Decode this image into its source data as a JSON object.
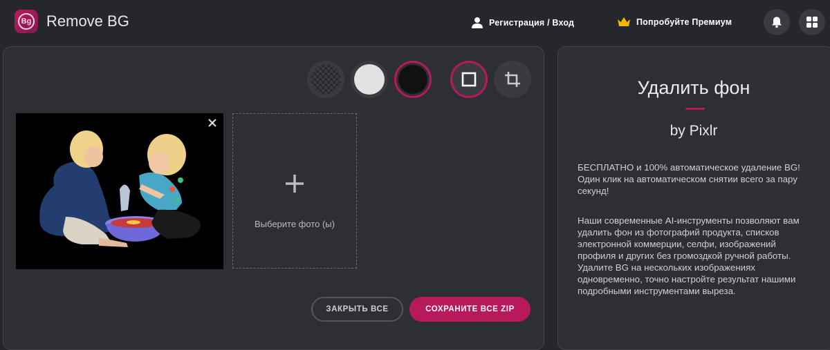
{
  "header": {
    "logo_text": "Bg",
    "app_title": "Remove BG",
    "login_label": "Регистрация / Вход",
    "premium_label": "Попробуйте Премиум",
    "icons": [
      "user-icon",
      "crown-icon",
      "bell-icon",
      "apps-grid-icon"
    ]
  },
  "toolbar": {
    "backgrounds": [
      "transparent",
      "#e2e2e2",
      "#111111"
    ],
    "selected_background": "#111111",
    "modes": [
      "border-mode",
      "crop-mode"
    ],
    "selected_mode": "border-mode"
  },
  "workspace": {
    "dropzone_label": "Выберите фото (ы)",
    "close_all_label": "ЗАКРЫТЬ ВСЕ",
    "save_all_label": "СОХРАНИТЕ ВСЕ ZIP"
  },
  "info": {
    "title": "Удалить фон",
    "subtitle": "by Pixlr",
    "paragraph1": "БЕСПЛАТНО и 100% автоматическое удаление BG! Один клик на автоматическом снятии всего за пару секунд!",
    "paragraph2": "Наши современные AI-инструменты позволяют вам удалить фон из фотографий продукта, списков электронной коммерции, селфи, изображений профиля и других без громоздкой ручной работы. Удалите BG на нескольких изображениях одновременно, точно настройте результат нашими подробными инструментами выреза."
  },
  "colors": {
    "accent": "#b7195c",
    "background": "#26272b",
    "panel": "#2e2f34",
    "crown": "#f2b600"
  }
}
